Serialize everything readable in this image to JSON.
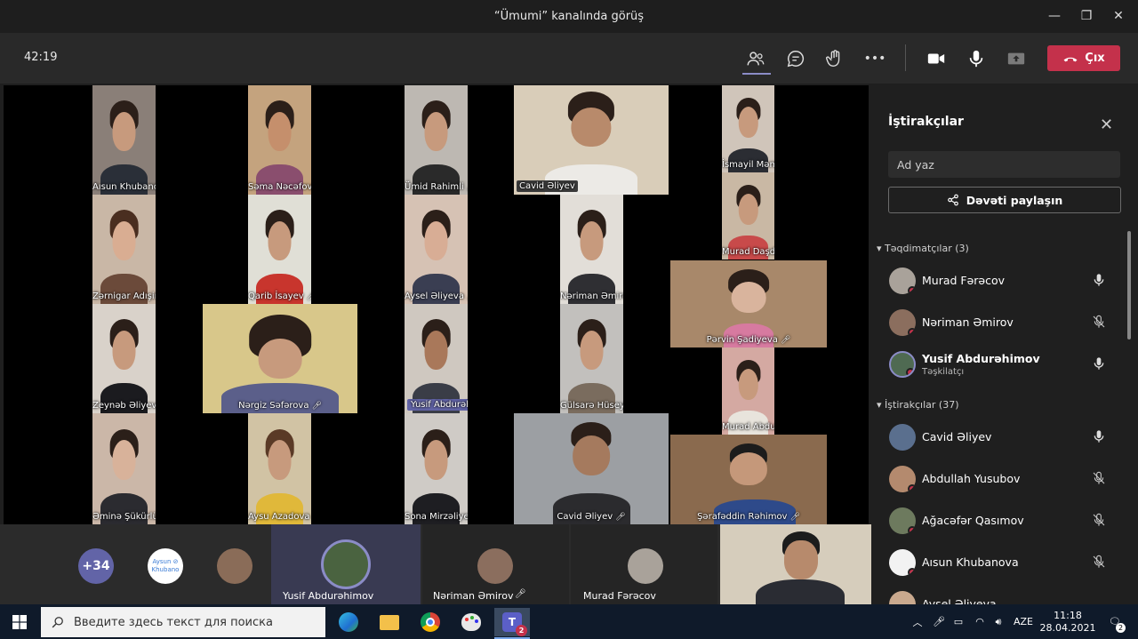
{
  "window": {
    "title": "“Ümumi” kanalında görüş",
    "minimize": "—",
    "maximize": "❐",
    "close": "✕"
  },
  "toolbar": {
    "timer": "42:19",
    "leave_label": "Çıx",
    "more": "•••"
  },
  "tiles": [
    {
      "name": "Aısun Khubanova"
    },
    {
      "name": "Səma Nəcəfova"
    },
    {
      "name": "Ümid Rahimli"
    },
    {
      "name": "Cavid Əliyev"
    },
    {
      "name": "İsmayil Məmmədov"
    },
    {
      "name": "Murad Daşdəmirov"
    },
    {
      "name": "Zərnigar Adışirinova"
    },
    {
      "name": "Qarib İsayev"
    },
    {
      "name": "Aysel Əliyeva"
    },
    {
      "name": "Nəriman Əmirov"
    },
    {
      "name": "Pərvin Şadiyeva"
    },
    {
      "name": "Zeynəb Əliyeva"
    },
    {
      "name": "Nərgiz Səfərova"
    },
    {
      "name": "Yusif Abdurəhimov"
    },
    {
      "name": "Gülsarə Hüseynzadə"
    },
    {
      "name": "Murad Abdurəhimov"
    },
    {
      "name": "Əminə Şükürlü"
    },
    {
      "name": "Aysu Azadova"
    },
    {
      "name": "Sona Mirzəliyeva"
    },
    {
      "name": "Cavid Əliyev"
    },
    {
      "name": "Şərafəddin Rəhimov"
    }
  ],
  "panel": {
    "title": "İştirakçılar",
    "search_placeholder": "Ad yaz",
    "share_label": "Dəvəti paylaşın",
    "presenters_header": "Təqdimatçılar (3)",
    "presenters": [
      {
        "name": "Murad Fərəcov",
        "role": "",
        "mic": "on"
      },
      {
        "name": "Nəriman Əmirov",
        "role": "",
        "mic": "muted"
      },
      {
        "name": "Yusif Abdurəhimov",
        "role": "Təşkilatçı",
        "mic": "on"
      }
    ],
    "attendees_header": "İştirakçılar (37)",
    "attendees": [
      {
        "name": "Cavid Əliyev",
        "mic": "on"
      },
      {
        "name": "Abdullah Yusubov",
        "mic": "muted"
      },
      {
        "name": "Ağacəfər Qasımov",
        "mic": "muted"
      },
      {
        "name": "Aısun Khubanova",
        "mic": "muted"
      },
      {
        "name": "Aysel Əliyeva",
        "mic": "muted"
      }
    ]
  },
  "strip": {
    "overflow_count": "+34",
    "aysun_avatar_text": "Aysun ⊘ Khubano",
    "names": [
      "Yusif Abdurəhimov",
      "Nəriman Əmirov",
      "Murad Fərəcov"
    ]
  },
  "taskbar": {
    "search_placeholder": "Введите здесь текст для поиска",
    "lang": "AZE",
    "time": "11:18",
    "date": "28.04.2021",
    "teams_badge": "2",
    "notif_badge": "2"
  }
}
